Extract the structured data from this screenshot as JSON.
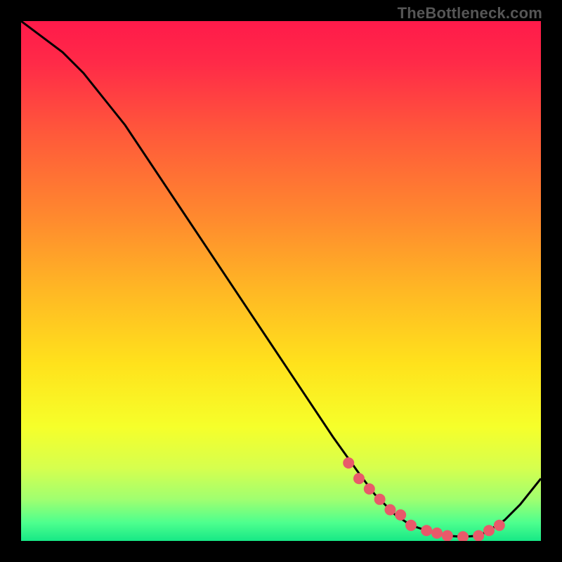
{
  "watermark": "TheBottleneck.com",
  "chart_data": {
    "type": "line",
    "title": "",
    "xlabel": "",
    "ylabel": "",
    "xlim": [
      0,
      100
    ],
    "ylim": [
      0,
      100
    ],
    "grid": false,
    "legend": false,
    "series": [
      {
        "name": "curve",
        "x": [
          0,
          4,
          8,
          12,
          16,
          20,
          28,
          36,
          44,
          52,
          60,
          65,
          68,
          70,
          72,
          75,
          78,
          82,
          85,
          88,
          90,
          93,
          96,
          100
        ],
        "values": [
          100,
          97,
          94,
          90,
          85,
          80,
          68,
          56,
          44,
          32,
          20,
          13,
          9,
          7,
          5,
          3,
          2,
          1,
          0.8,
          1,
          2,
          4,
          7,
          12
        ]
      }
    ],
    "points": {
      "name": "markers",
      "x": [
        63,
        65,
        67,
        69,
        71,
        73,
        75,
        78,
        80,
        82,
        85,
        88,
        90,
        92
      ],
      "values": [
        15,
        12,
        10,
        8,
        6,
        5,
        3,
        2,
        1.5,
        1,
        0.8,
        1,
        2,
        3
      ]
    },
    "gradient_stops": [
      {
        "offset": 0.0,
        "color": "#ff1a4a"
      },
      {
        "offset": 0.08,
        "color": "#ff2a48"
      },
      {
        "offset": 0.22,
        "color": "#ff5a3a"
      },
      {
        "offset": 0.38,
        "color": "#ff8a2e"
      },
      {
        "offset": 0.52,
        "color": "#ffb824"
      },
      {
        "offset": 0.66,
        "color": "#ffe21c"
      },
      {
        "offset": 0.78,
        "color": "#f6ff2a"
      },
      {
        "offset": 0.86,
        "color": "#d6ff4e"
      },
      {
        "offset": 0.92,
        "color": "#a0ff70"
      },
      {
        "offset": 0.965,
        "color": "#4dff8e"
      },
      {
        "offset": 1.0,
        "color": "#17e886"
      }
    ],
    "marker_color": "#e85a6a",
    "curve_color": "#000000"
  }
}
